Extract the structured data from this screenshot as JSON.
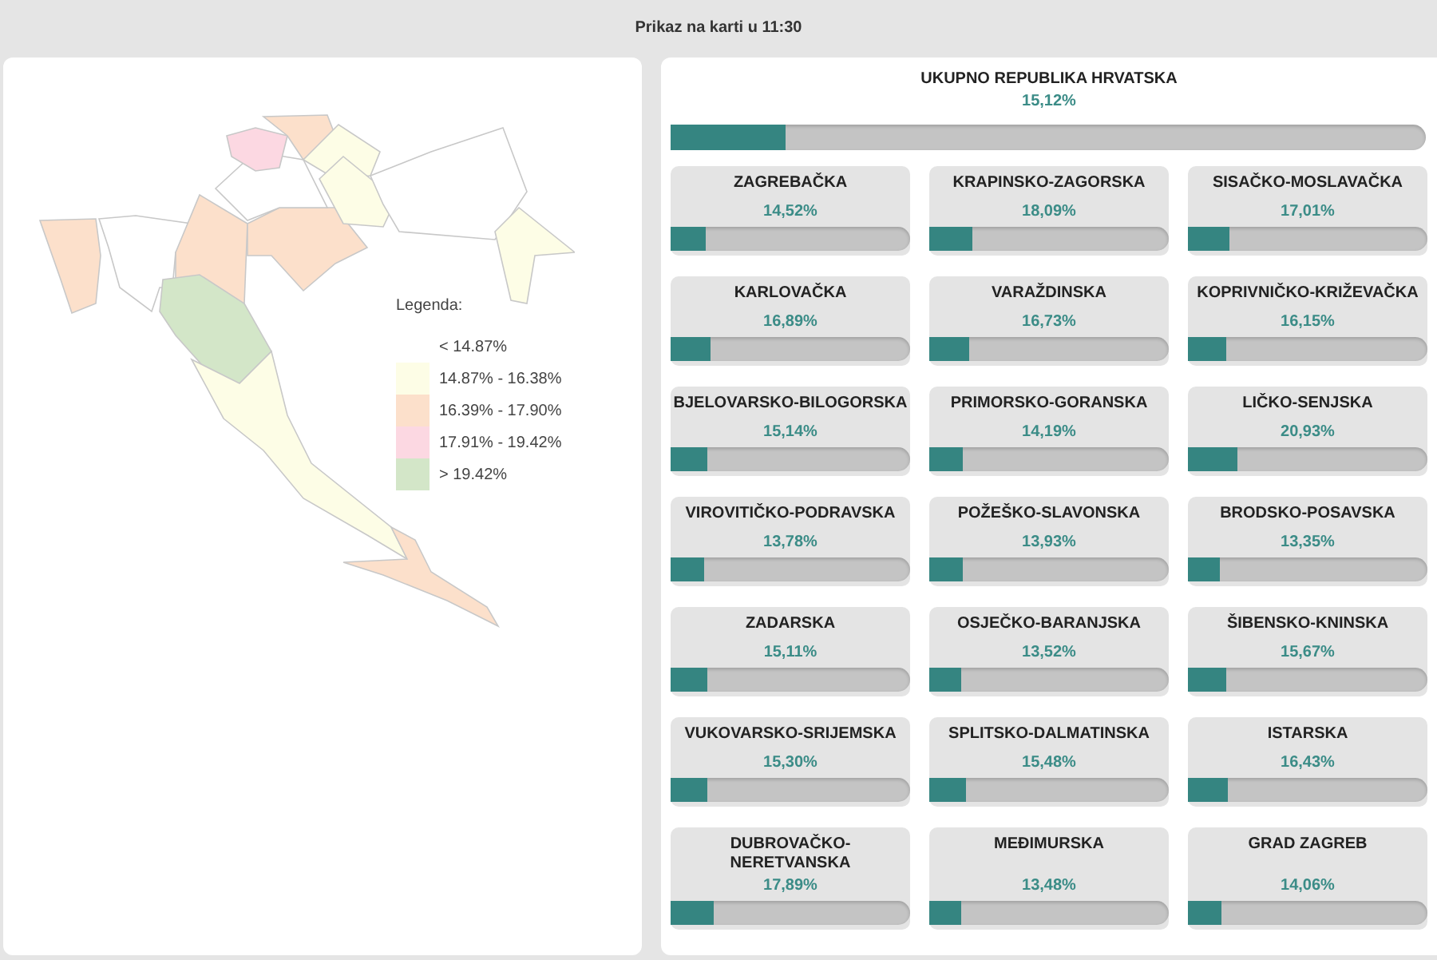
{
  "header": {
    "title": "Prikaz na karti u 11:30"
  },
  "legend": {
    "title": "Legenda:",
    "items": [
      {
        "label": "< 14.87%"
      },
      {
        "label": "14.87% - 16.38%",
        "color": "#fdfde6"
      },
      {
        "label": "16.39% - 17.90%",
        "color": "#fce0cb"
      },
      {
        "label": "17.91% - 19.42%",
        "color": "#fcd8e2"
      },
      {
        "label": "> 19.42%",
        "color": "#d3e6c8"
      }
    ]
  },
  "total": {
    "name": "UKUPNO REPUBLIKA HRVATSKA",
    "value": "15,12%",
    "level": 0.1512
  },
  "counties": [
    {
      "name": "ZAGREBAČKA",
      "value": "14,52%",
      "level": 0.1452
    },
    {
      "name": "KRAPINSKO-ZAGORSKA",
      "value": "18,09%",
      "level": 0.1809
    },
    {
      "name": "SISAČKO-MOSLAVAČKA",
      "value": "17,01%",
      "level": 0.1701
    },
    {
      "name": "KARLOVAČKA",
      "value": "16,89%",
      "level": 0.1689
    },
    {
      "name": "VARAŽDINSKA",
      "value": "16,73%",
      "level": 0.1673
    },
    {
      "name": "KOPRIVNIČKO-KRIŽEVAČKA",
      "value": "16,15%",
      "level": 0.1615
    },
    {
      "name": "BJELOVARSKO-BILOGORSKA",
      "value": "15,14%",
      "level": 0.1514
    },
    {
      "name": "PRIMORSKO-GORANSKA",
      "value": "14,19%",
      "level": 0.1419
    },
    {
      "name": "LIČKO-SENJSKA",
      "value": "20,93%",
      "level": 0.2093
    },
    {
      "name": "VIROVITIČKO-PODRAVSKA",
      "value": "13,78%",
      "level": 0.1378
    },
    {
      "name": "POŽEŠKO-SLAVONSKA",
      "value": "13,93%",
      "level": 0.1393
    },
    {
      "name": "BRODSKO-POSAVSKA",
      "value": "13,35%",
      "level": 0.1335
    },
    {
      "name": "ZADARSKA",
      "value": "15,11%",
      "level": 0.1511
    },
    {
      "name": "OSJEČKO-BARANJSKA",
      "value": "13,52%",
      "level": 0.1352
    },
    {
      "name": "ŠIBENSKO-KNINSKA",
      "value": "15,67%",
      "level": 0.1567
    },
    {
      "name": "VUKOVARSKO-SRIJEMSKA",
      "value": "15,30%",
      "level": 0.153
    },
    {
      "name": "SPLITSKO-DALMATINSKA",
      "value": "15,48%",
      "level": 0.1548
    },
    {
      "name": "ISTARSKA",
      "value": "16,43%",
      "level": 0.1643
    },
    {
      "name": "DUBROVAČKO-NERETVANSKA",
      "value": "17,89%",
      "level": 0.1789
    },
    {
      "name": "MEĐIMURSKA",
      "value": "13,48%",
      "level": 0.1348
    },
    {
      "name": "GRAD ZAGREB",
      "value": "14,06%",
      "level": 0.1406
    }
  ]
}
